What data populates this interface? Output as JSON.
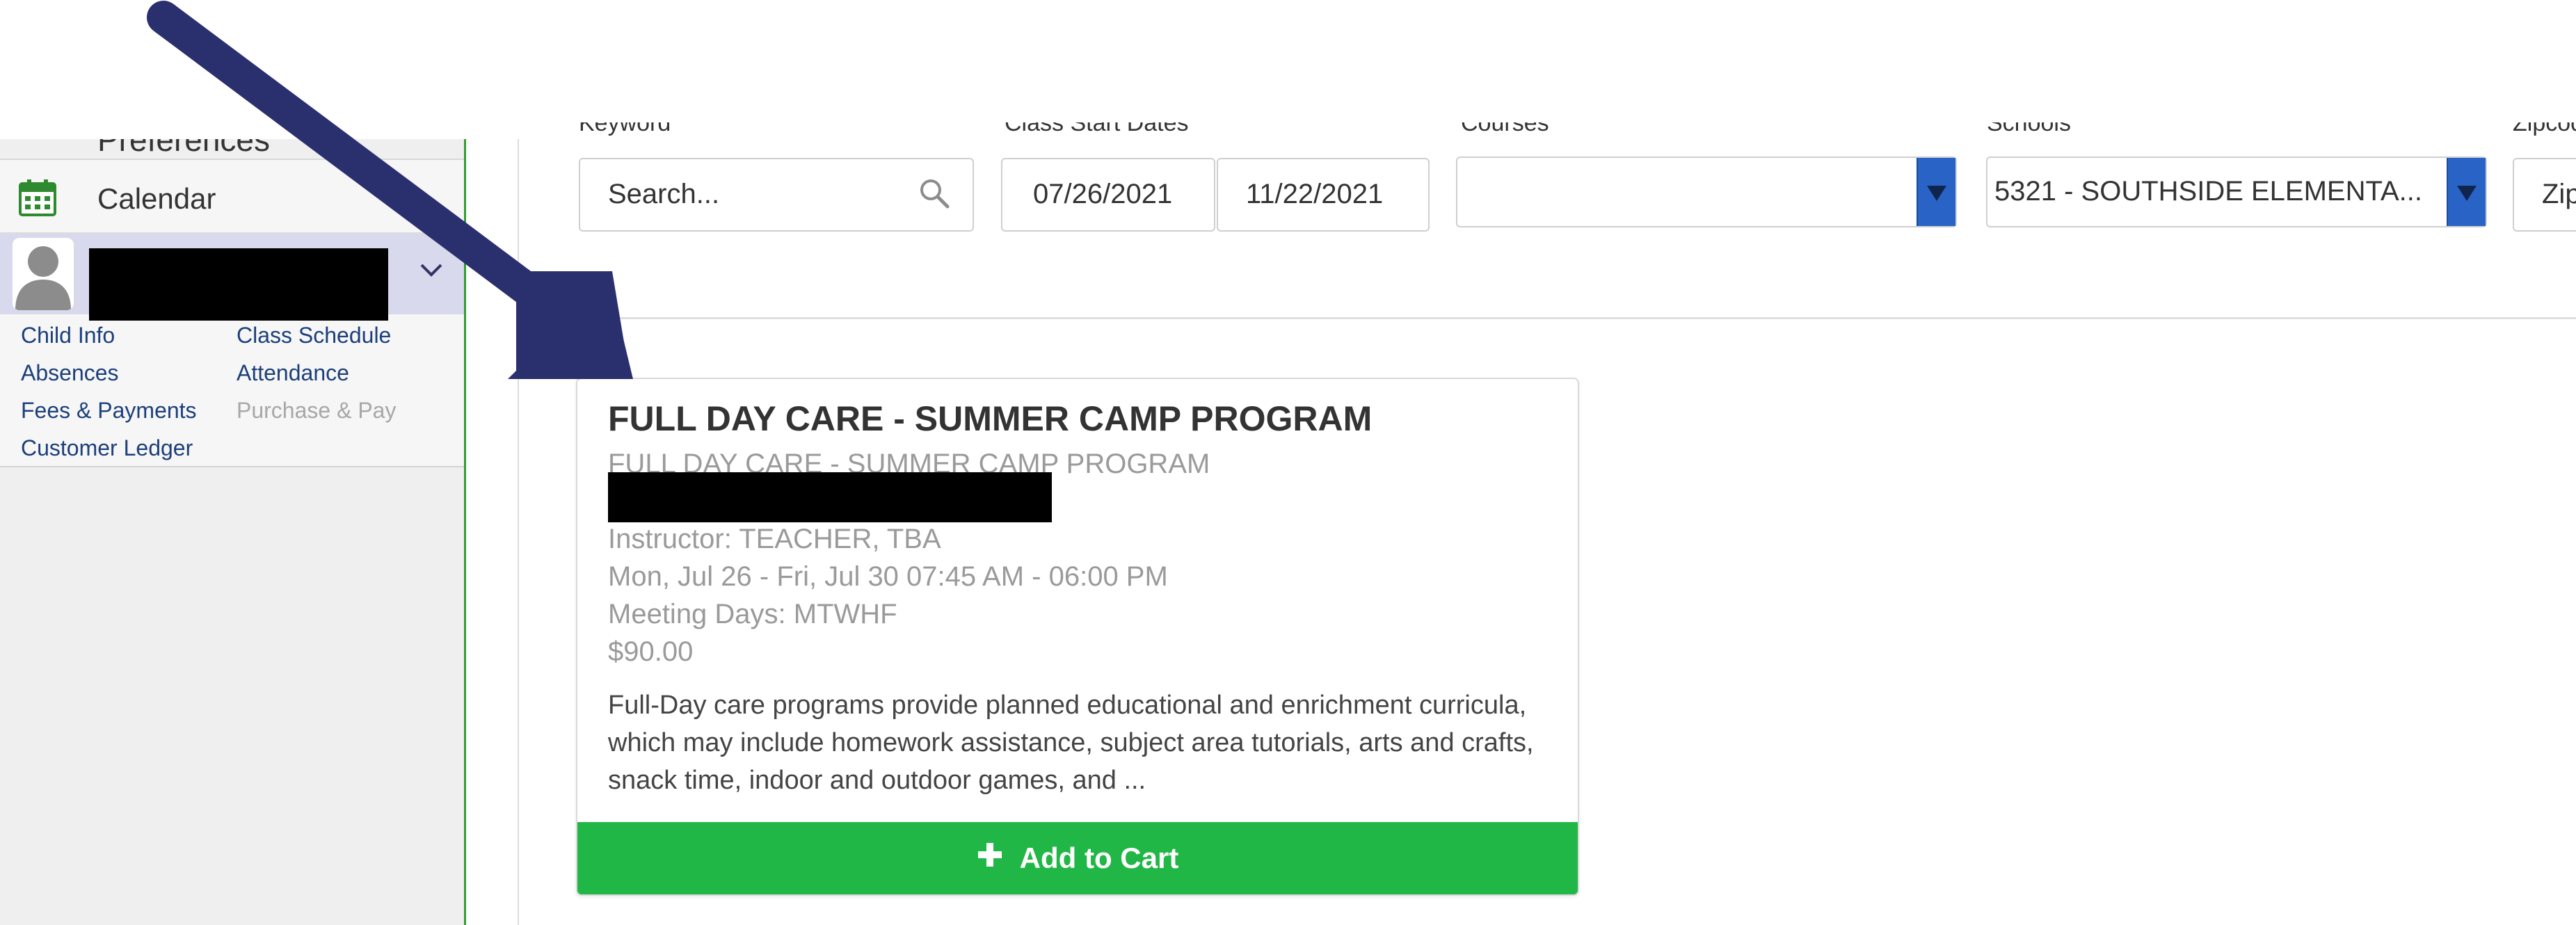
{
  "sidebar": {
    "prev_item": "Preferences",
    "calendar_label": "Calendar",
    "child_links": {
      "child_info": "Child Info",
      "class_schedule": "Class Schedule",
      "absences": "Absences",
      "attendance": "Attendance",
      "fees_payments": "Fees & Payments",
      "purchase_pay": "Purchase & Pay",
      "customer_ledger": "Customer Ledger"
    }
  },
  "filters": {
    "keyword_label": "Keyword",
    "search_placeholder": "Search...",
    "date_label": "Class Start Dates",
    "start_date": "07/26/2021",
    "end_date": "11/22/2021",
    "courses_label": "Courses",
    "courses_value": "",
    "schools_label": "Schools",
    "schools_value": "5321 - SOUTHSIDE ELEMENTA...",
    "zip_label": "Zipcode",
    "zip_placeholder": "Zip"
  },
  "card": {
    "title": "FULL DAY CARE - SUMMER CAMP PROGRAM",
    "subtitle": "FULL DAY CARE - SUMMER CAMP PROGRAM",
    "instructor": "Instructor: TEACHER, TBA",
    "schedule": "Mon, Jul 26 - Fri, Jul 30 07:45 AM - 06:00 PM",
    "meeting_days": "Meeting Days: MTWHF",
    "price": "$90.00",
    "description": "Full-Day care programs provide planned educational and enrichment curricula, which may include homework assistance, subject area tutorials, arts and crafts, snack time, indoor and outdoor games, and ...",
    "add_to_cart_label": "Add to Cart"
  },
  "colors": {
    "accent_green": "#21b746",
    "sidebar_border_green": "#2e9e2e",
    "select_blue": "#2a63c6",
    "arrow_navy": "#2a2f6e",
    "child_header_bg": "#d9d9ed"
  }
}
